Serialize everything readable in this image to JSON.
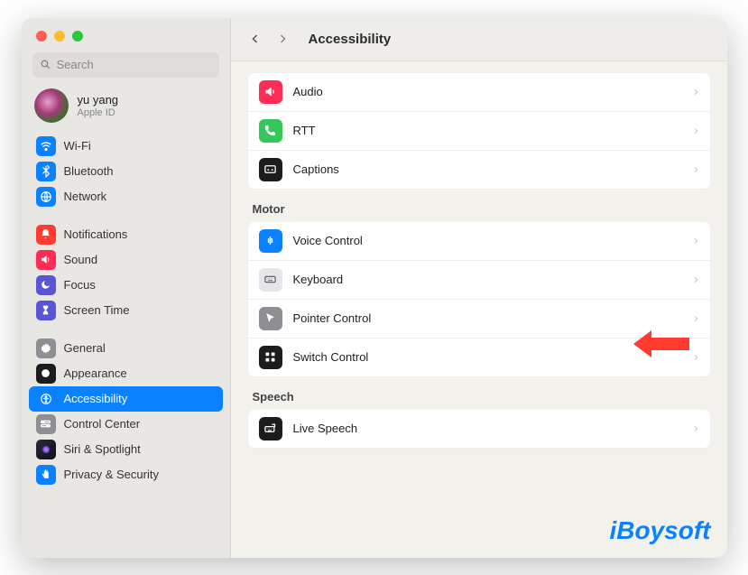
{
  "window": {
    "search_placeholder": "Search",
    "user": {
      "name": "yu yang",
      "subtitle": "Apple ID"
    }
  },
  "sidebar": {
    "items": [
      {
        "label": "Wi-Fi"
      },
      {
        "label": "Bluetooth"
      },
      {
        "label": "Network"
      },
      {
        "label": "Notifications"
      },
      {
        "label": "Sound"
      },
      {
        "label": "Focus"
      },
      {
        "label": "Screen Time"
      },
      {
        "label": "General"
      },
      {
        "label": "Appearance"
      },
      {
        "label": "Accessibility"
      },
      {
        "label": "Control Center"
      },
      {
        "label": "Siri & Spotlight"
      },
      {
        "label": "Privacy & Security"
      }
    ]
  },
  "header": {
    "title": "Accessibility"
  },
  "content": {
    "hearing_rows": [
      {
        "label": "Audio"
      },
      {
        "label": "RTT"
      },
      {
        "label": "Captions"
      }
    ],
    "motor_title": "Motor",
    "motor_rows": [
      {
        "label": "Voice Control"
      },
      {
        "label": "Keyboard"
      },
      {
        "label": "Pointer Control"
      },
      {
        "label": "Switch Control"
      }
    ],
    "speech_title": "Speech",
    "speech_rows": [
      {
        "label": "Live Speech"
      }
    ]
  },
  "watermark": "iBoysoft"
}
